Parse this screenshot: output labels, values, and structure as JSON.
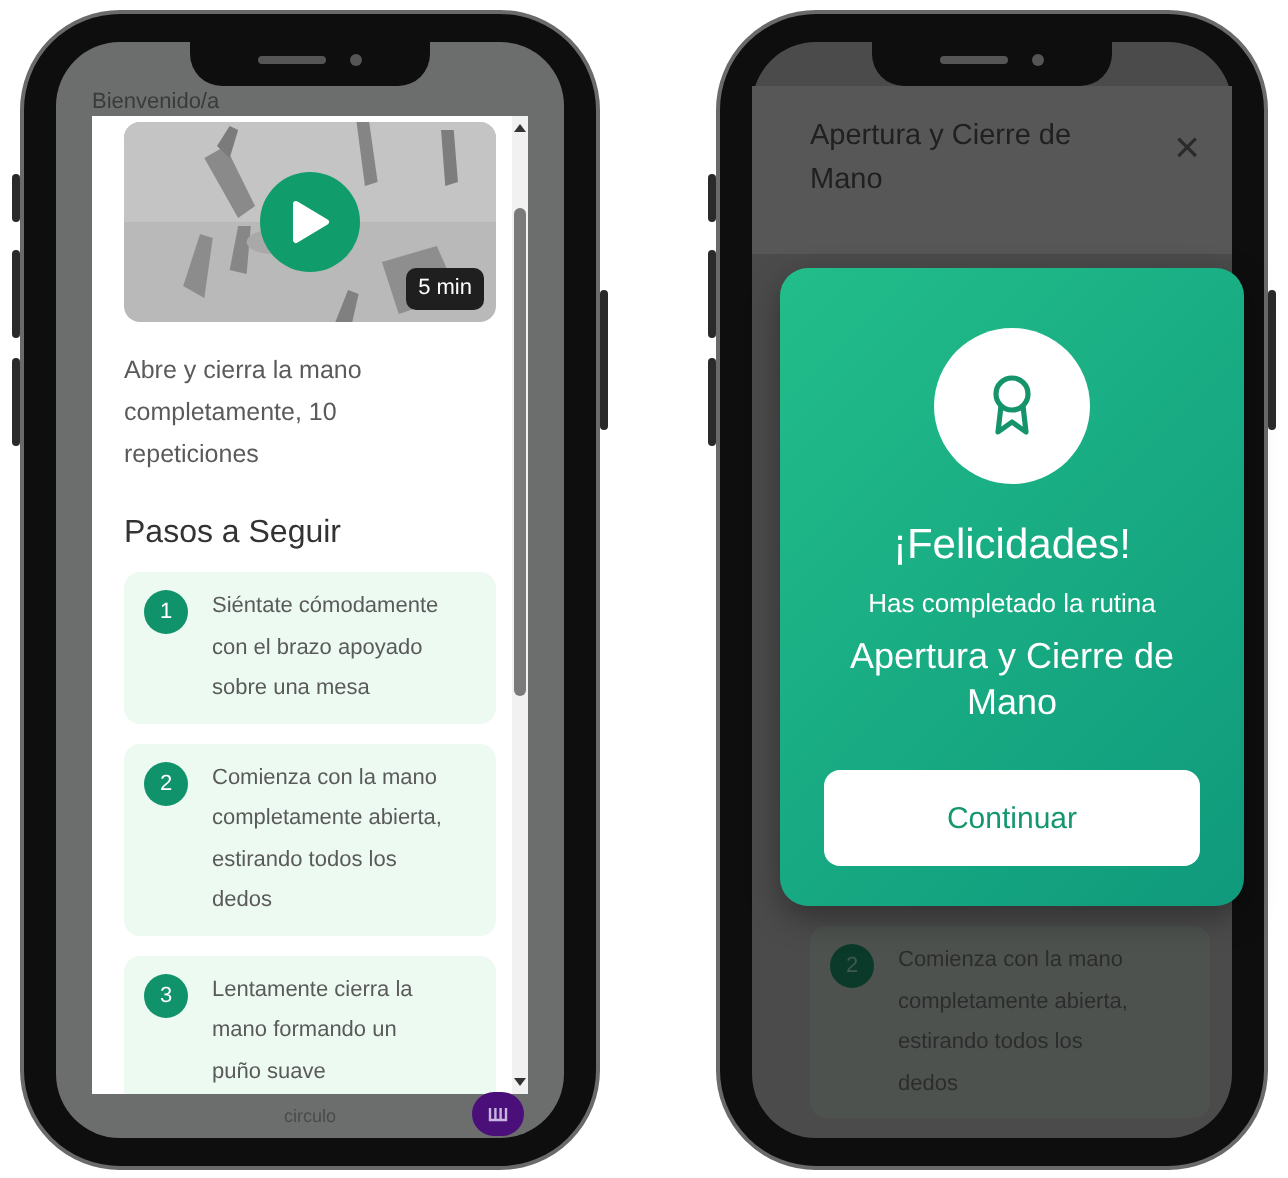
{
  "phones": [
    {
      "kind": "routine",
      "background_title": "Bienvenido/a",
      "video": {
        "duration": "5 min"
      },
      "description": "Abre y cierra la mano completamente, 10 repeticiones",
      "steps_heading": "Pasos a Seguir",
      "steps": [
        {
          "number": "1",
          "text": "Siéntate cómodamente con el brazo apoyado sobre una mesa"
        },
        {
          "number": "2",
          "text": "Comienza con la mano completamente abierta, estirando todos los dedos"
        },
        {
          "number": "3",
          "text": "Lentamente cierra la mano formando un puño suave"
        }
      ],
      "bottom_label": "circulo"
    },
    {
      "kind": "completed",
      "header": {
        "title": "Apertura y Cierre de Mano",
        "close": "×"
      },
      "steps": [
        {
          "number": "2",
          "text": "Comienza con la mano completamente abierta, estirando todos los dedos"
        }
      ],
      "dialog": {
        "title": "¡Felicidades!",
        "message": "Has completado la rutina",
        "routine": "Apertura y Cierre de Mano",
        "button": "Continuar"
      }
    }
  ]
}
